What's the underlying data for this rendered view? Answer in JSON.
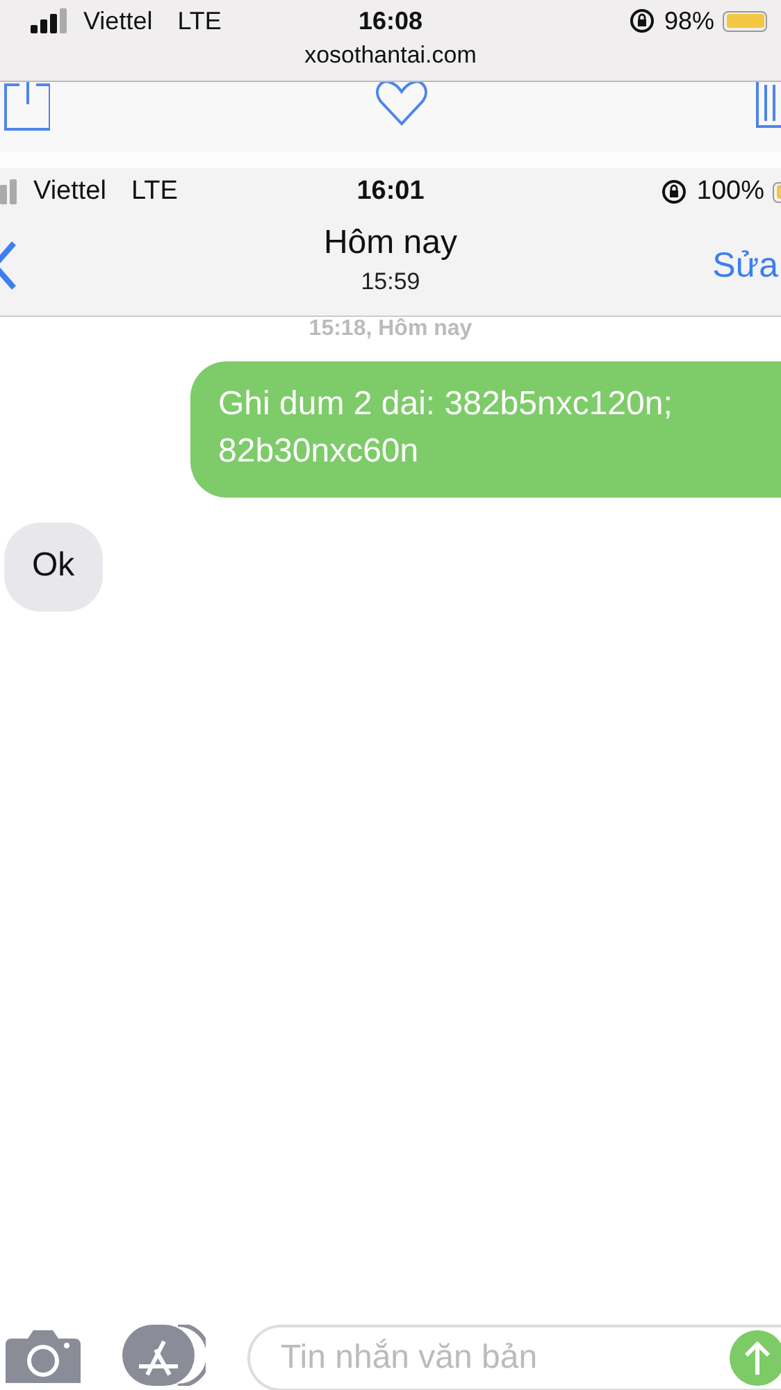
{
  "outer_status": {
    "carrier": "Viettel",
    "network": "LTE",
    "time": "16:08",
    "battery": "98%"
  },
  "url": "xosothantai.com",
  "inner_status": {
    "carrier": "Viettel",
    "network": "LTE",
    "time": "16:01",
    "battery": "100%"
  },
  "nav": {
    "title": "Hôm nay",
    "subtitle": "15:59",
    "edit": "Sửa"
  },
  "timestamp": "15:18, Hôm nay",
  "messages": [
    {
      "kind": "sent",
      "text": "Ghi dum 2 dai: 382b5nxc120n; 82b30nxc60n"
    },
    {
      "kind": "received",
      "text": "Ok"
    }
  ],
  "composer": {
    "placeholder": "Tin nhắn văn bản"
  }
}
